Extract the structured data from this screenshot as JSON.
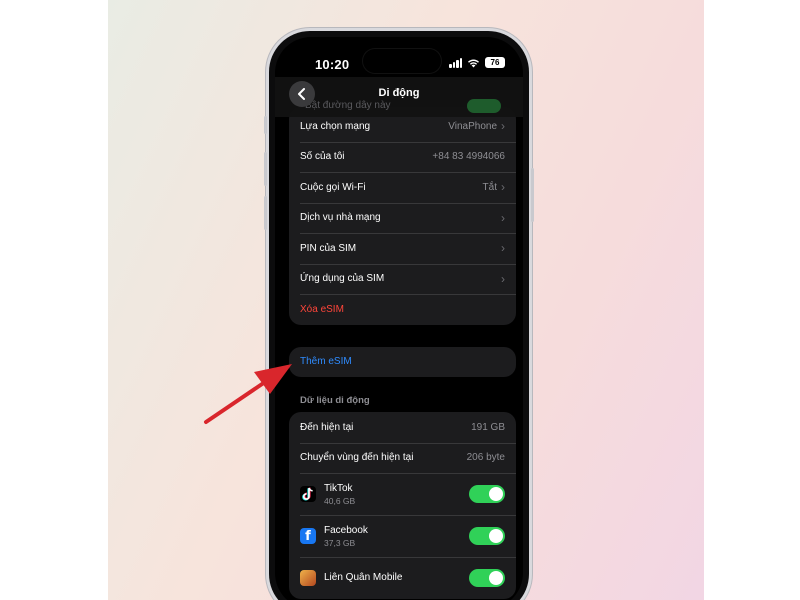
{
  "status_bar": {
    "time": "10:20",
    "battery": "76"
  },
  "nav": {
    "title": "Di động",
    "hidden_row_label": "Bật đường dây này"
  },
  "settings": [
    {
      "label": "Lựa chọn mạng",
      "value": "VinaPhone",
      "chevron": true
    },
    {
      "label": "Số của tôi",
      "value": "+84 83 4994066",
      "chevron": false
    },
    {
      "label": "Cuộc gọi Wi-Fi",
      "value": "Tắt",
      "chevron": true
    },
    {
      "label": "Dịch vụ nhà mạng",
      "value": "",
      "chevron": true
    },
    {
      "label": "PIN của SIM",
      "value": "",
      "chevron": true
    },
    {
      "label": "Ứng dụng của SIM",
      "value": "",
      "chevron": true
    },
    {
      "label": "Xóa eSIM",
      "value": "",
      "chevron": false,
      "color": "#ff453a"
    }
  ],
  "add_esim": {
    "label": "Thêm eSIM",
    "color": "#2f8cff"
  },
  "mobile_data": {
    "header": "Dữ liệu di động",
    "current_period": {
      "label": "Đến hiện tại",
      "value": "191 GB"
    },
    "roaming": {
      "label": "Chuyển vùng đến hiện tại",
      "value": "206 byte"
    },
    "apps": [
      {
        "name": "TikTok",
        "size": "40,6 GB",
        "icon": "tiktok-icon",
        "enabled": true
      },
      {
        "name": "Facebook",
        "size": "37,3 GB",
        "icon": "facebook-icon",
        "enabled": true
      },
      {
        "name": "Liên Quân Mobile",
        "size": "",
        "icon": "lien-quan-icon",
        "enabled": true
      }
    ]
  },
  "colors": {
    "toggle_on": "#30d158",
    "annotation_arrow": "#d9262c"
  }
}
